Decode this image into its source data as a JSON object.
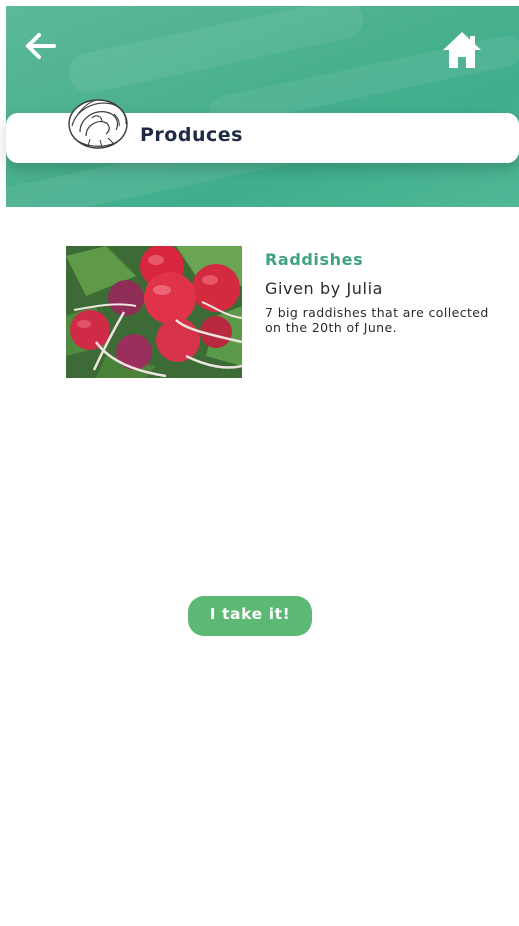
{
  "header": {
    "title": "Produces",
    "back_icon": "arrow-left-icon",
    "home_icon": "home-icon",
    "category_icon": "cabbage-icon"
  },
  "item": {
    "name": "Raddishes",
    "giver": "Given by Julia",
    "description": "7 big raddishes that are collected on the 20th of June."
  },
  "actions": {
    "take_label": "I take it!"
  },
  "colors": {
    "header_green": "#49b08f",
    "title_text": "#1f2a44",
    "item_name": "#3fa37f",
    "button_green": "#5cb973"
  }
}
